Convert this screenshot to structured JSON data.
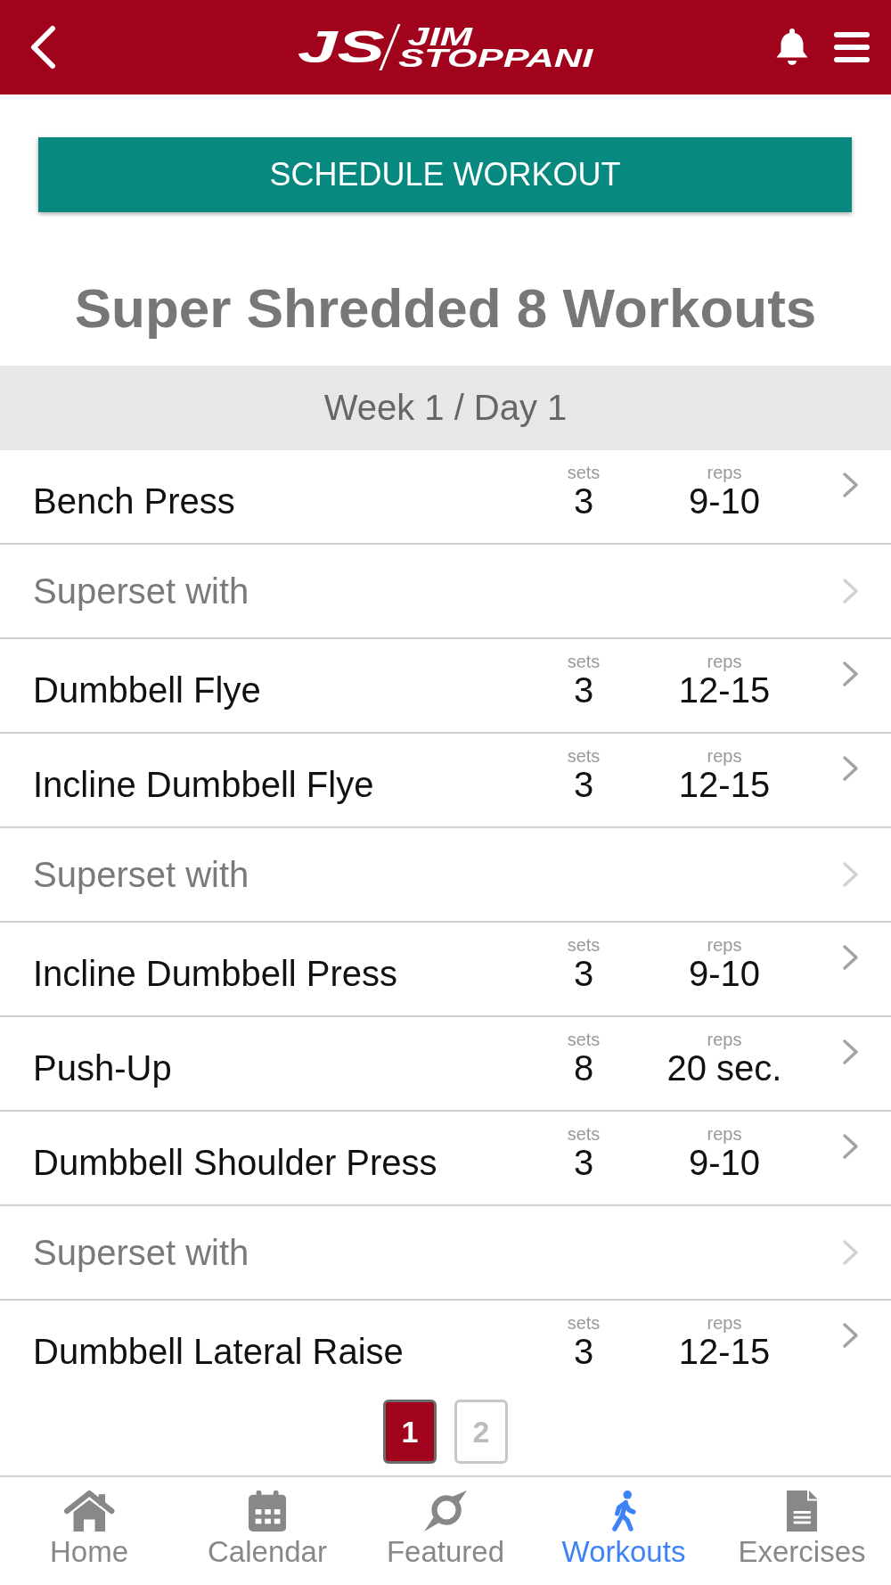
{
  "header": {
    "logo": {
      "monogram": "JS",
      "line_1": "JIM",
      "line_2": "STOPPANI"
    }
  },
  "schedule_button": "SCHEDULE WORKOUT",
  "title": "Super Shredded 8 Workouts",
  "day_header": "Week 1 / Day 1",
  "exercises": [
    {
      "kind": "exercise",
      "name": "Bench Press",
      "sets_label": "sets",
      "sets": "3",
      "reps_label": "reps",
      "reps": "9-10"
    },
    {
      "kind": "superset",
      "name": "Superset with"
    },
    {
      "kind": "exercise",
      "name": "Dumbbell Flye",
      "sets_label": "sets",
      "sets": "3",
      "reps_label": "reps",
      "reps": "12-15"
    },
    {
      "kind": "exercise",
      "name": "Incline Dumbbell Flye",
      "sets_label": "sets",
      "sets": "3",
      "reps_label": "reps",
      "reps": "12-15"
    },
    {
      "kind": "superset",
      "name": "Superset with"
    },
    {
      "kind": "exercise",
      "name": "Incline Dumbbell Press",
      "sets_label": "sets",
      "sets": "3",
      "reps_label": "reps",
      "reps": "9-10"
    },
    {
      "kind": "exercise",
      "name": "Push-Up",
      "sets_label": "sets",
      "sets": "8",
      "reps_label": "reps",
      "reps": "20 sec."
    },
    {
      "kind": "exercise",
      "name": "Dumbbell Shoulder Press",
      "sets_label": "sets",
      "sets": "3",
      "reps_label": "reps",
      "reps": "9-10"
    },
    {
      "kind": "superset",
      "name": "Superset with"
    },
    {
      "kind": "exercise",
      "name": "Dumbbell Lateral Raise",
      "sets_label": "sets",
      "sets": "3",
      "reps_label": "reps",
      "reps": "12-15"
    }
  ],
  "pagination": [
    {
      "label": "1",
      "selected": true
    },
    {
      "label": "2",
      "selected": false
    }
  ],
  "tab_bar": [
    {
      "label": "Home",
      "selected": false
    },
    {
      "label": "Calendar",
      "selected": false
    },
    {
      "label": "Featured",
      "selected": false
    },
    {
      "label": "Workouts",
      "selected": true
    },
    {
      "label": "Exercises",
      "selected": false
    }
  ]
}
